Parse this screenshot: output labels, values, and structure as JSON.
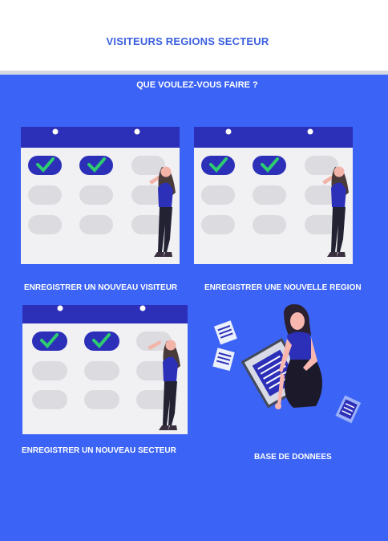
{
  "header": {
    "title": "VISITEURS REGIONS SECTEUR"
  },
  "main": {
    "subtitle": "QUE VOULEZ-VOUS FAIRE ?",
    "options": [
      {
        "label": "ENREGISTRER UN NOUVEAU VISITEUR",
        "icon": "calendar-checklist-illustration"
      },
      {
        "label": "ENREGISTRER UNE NOUVELLE REGION",
        "icon": "calendar-checklist-illustration"
      },
      {
        "label": "ENREGISTRER UN NOUVEAU SECTEUR",
        "icon": "calendar-checklist-illustration"
      },
      {
        "label": "BASE DE DONNEES",
        "icon": "database-documents-illustration"
      }
    ]
  },
  "colors": {
    "accent": "#3b63f5",
    "title": "#3a5fe0",
    "calendar_bar": "#2c2fb8",
    "check": "#2ecc71"
  }
}
